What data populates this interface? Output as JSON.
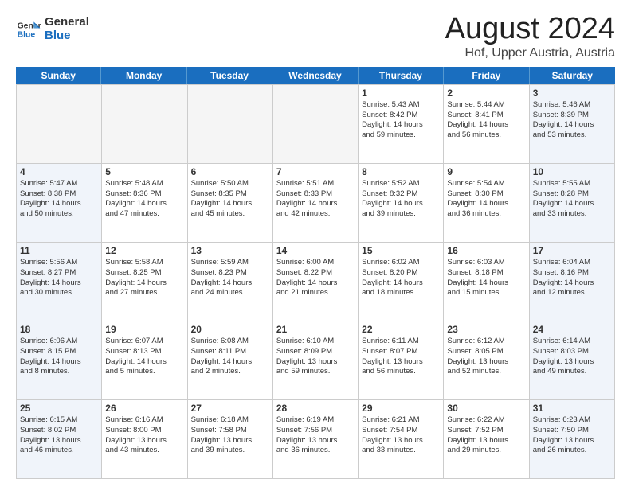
{
  "header": {
    "logo_line1": "General",
    "logo_line2": "Blue",
    "title": "August 2024",
    "subtitle": "Hof, Upper Austria, Austria"
  },
  "calendar": {
    "days_of_week": [
      "Sunday",
      "Monday",
      "Tuesday",
      "Wednesday",
      "Thursday",
      "Friday",
      "Saturday"
    ],
    "weeks": [
      [
        {
          "day": "",
          "info": "",
          "empty": true
        },
        {
          "day": "",
          "info": "",
          "empty": true
        },
        {
          "day": "",
          "info": "",
          "empty": true
        },
        {
          "day": "",
          "info": "",
          "empty": true
        },
        {
          "day": "1",
          "info": "Sunrise: 5:43 AM\nSunset: 8:42 PM\nDaylight: 14 hours\nand 59 minutes.",
          "shaded": false
        },
        {
          "day": "2",
          "info": "Sunrise: 5:44 AM\nSunset: 8:41 PM\nDaylight: 14 hours\nand 56 minutes.",
          "shaded": false
        },
        {
          "day": "3",
          "info": "Sunrise: 5:46 AM\nSunset: 8:39 PM\nDaylight: 14 hours\nand 53 minutes.",
          "shaded": true
        }
      ],
      [
        {
          "day": "4",
          "info": "Sunrise: 5:47 AM\nSunset: 8:38 PM\nDaylight: 14 hours\nand 50 minutes.",
          "shaded": true
        },
        {
          "day": "5",
          "info": "Sunrise: 5:48 AM\nSunset: 8:36 PM\nDaylight: 14 hours\nand 47 minutes.",
          "shaded": false
        },
        {
          "day": "6",
          "info": "Sunrise: 5:50 AM\nSunset: 8:35 PM\nDaylight: 14 hours\nand 45 minutes.",
          "shaded": false
        },
        {
          "day": "7",
          "info": "Sunrise: 5:51 AM\nSunset: 8:33 PM\nDaylight: 14 hours\nand 42 minutes.",
          "shaded": false
        },
        {
          "day": "8",
          "info": "Sunrise: 5:52 AM\nSunset: 8:32 PM\nDaylight: 14 hours\nand 39 minutes.",
          "shaded": false
        },
        {
          "day": "9",
          "info": "Sunrise: 5:54 AM\nSunset: 8:30 PM\nDaylight: 14 hours\nand 36 minutes.",
          "shaded": false
        },
        {
          "day": "10",
          "info": "Sunrise: 5:55 AM\nSunset: 8:28 PM\nDaylight: 14 hours\nand 33 minutes.",
          "shaded": true
        }
      ],
      [
        {
          "day": "11",
          "info": "Sunrise: 5:56 AM\nSunset: 8:27 PM\nDaylight: 14 hours\nand 30 minutes.",
          "shaded": true
        },
        {
          "day": "12",
          "info": "Sunrise: 5:58 AM\nSunset: 8:25 PM\nDaylight: 14 hours\nand 27 minutes.",
          "shaded": false
        },
        {
          "day": "13",
          "info": "Sunrise: 5:59 AM\nSunset: 8:23 PM\nDaylight: 14 hours\nand 24 minutes.",
          "shaded": false
        },
        {
          "day": "14",
          "info": "Sunrise: 6:00 AM\nSunset: 8:22 PM\nDaylight: 14 hours\nand 21 minutes.",
          "shaded": false
        },
        {
          "day": "15",
          "info": "Sunrise: 6:02 AM\nSunset: 8:20 PM\nDaylight: 14 hours\nand 18 minutes.",
          "shaded": false
        },
        {
          "day": "16",
          "info": "Sunrise: 6:03 AM\nSunset: 8:18 PM\nDaylight: 14 hours\nand 15 minutes.",
          "shaded": false
        },
        {
          "day": "17",
          "info": "Sunrise: 6:04 AM\nSunset: 8:16 PM\nDaylight: 14 hours\nand 12 minutes.",
          "shaded": true
        }
      ],
      [
        {
          "day": "18",
          "info": "Sunrise: 6:06 AM\nSunset: 8:15 PM\nDaylight: 14 hours\nand 8 minutes.",
          "shaded": true
        },
        {
          "day": "19",
          "info": "Sunrise: 6:07 AM\nSunset: 8:13 PM\nDaylight: 14 hours\nand 5 minutes.",
          "shaded": false
        },
        {
          "day": "20",
          "info": "Sunrise: 6:08 AM\nSunset: 8:11 PM\nDaylight: 14 hours\nand 2 minutes.",
          "shaded": false
        },
        {
          "day": "21",
          "info": "Sunrise: 6:10 AM\nSunset: 8:09 PM\nDaylight: 13 hours\nand 59 minutes.",
          "shaded": false
        },
        {
          "day": "22",
          "info": "Sunrise: 6:11 AM\nSunset: 8:07 PM\nDaylight: 13 hours\nand 56 minutes.",
          "shaded": false
        },
        {
          "day": "23",
          "info": "Sunrise: 6:12 AM\nSunset: 8:05 PM\nDaylight: 13 hours\nand 52 minutes.",
          "shaded": false
        },
        {
          "day": "24",
          "info": "Sunrise: 6:14 AM\nSunset: 8:03 PM\nDaylight: 13 hours\nand 49 minutes.",
          "shaded": true
        }
      ],
      [
        {
          "day": "25",
          "info": "Sunrise: 6:15 AM\nSunset: 8:02 PM\nDaylight: 13 hours\nand 46 minutes.",
          "shaded": true
        },
        {
          "day": "26",
          "info": "Sunrise: 6:16 AM\nSunset: 8:00 PM\nDaylight: 13 hours\nand 43 minutes.",
          "shaded": false
        },
        {
          "day": "27",
          "info": "Sunrise: 6:18 AM\nSunset: 7:58 PM\nDaylight: 13 hours\nand 39 minutes.",
          "shaded": false
        },
        {
          "day": "28",
          "info": "Sunrise: 6:19 AM\nSunset: 7:56 PM\nDaylight: 13 hours\nand 36 minutes.",
          "shaded": false
        },
        {
          "day": "29",
          "info": "Sunrise: 6:21 AM\nSunset: 7:54 PM\nDaylight: 13 hours\nand 33 minutes.",
          "shaded": false
        },
        {
          "day": "30",
          "info": "Sunrise: 6:22 AM\nSunset: 7:52 PM\nDaylight: 13 hours\nand 29 minutes.",
          "shaded": false
        },
        {
          "day": "31",
          "info": "Sunrise: 6:23 AM\nSunset: 7:50 PM\nDaylight: 13 hours\nand 26 minutes.",
          "shaded": true
        }
      ]
    ]
  }
}
